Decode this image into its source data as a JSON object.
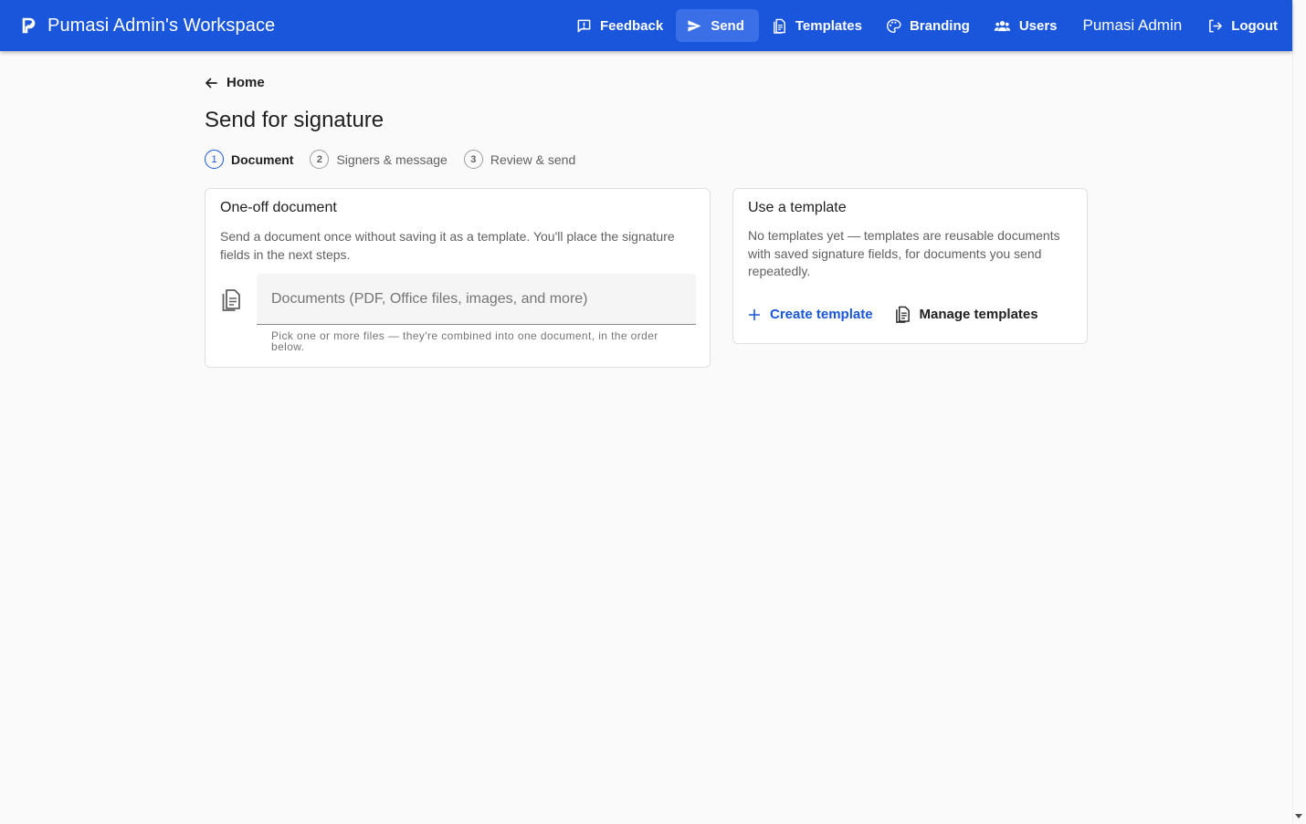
{
  "app": {
    "title": "Pumasi Admin's Workspace"
  },
  "nav": {
    "feedback": "Feedback",
    "send": "Send",
    "templates": "Templates",
    "branding": "Branding",
    "users": "Users",
    "user_name": "Pumasi Admin",
    "logout": "Logout"
  },
  "page": {
    "back_label": "Home",
    "title": "Send for signature"
  },
  "stepper": {
    "steps": [
      {
        "number": "1",
        "label": "Document",
        "active": true
      },
      {
        "number": "2",
        "label": "Signers & message",
        "active": false
      },
      {
        "number": "3",
        "label": "Review & send",
        "active": false
      }
    ]
  },
  "oneoff": {
    "title": "One-off document",
    "description": "Send a document once without saving it as a template. You'll place the signature fields in the next steps.",
    "file_placeholder": "Documents (PDF, Office files, images, and more)",
    "file_hint": "Pick one or more files — they're combined into one document, in the order below."
  },
  "template": {
    "title": "Use a template",
    "description": "No templates yet — templates are reusable documents with saved signature fields, for documents you send repeatedly.",
    "create_label": "Create template",
    "manage_label": "Manage templates"
  },
  "colors": {
    "primary": "#1a56db",
    "appbar_active": "#3a6fe8",
    "background": "#fafafa"
  }
}
